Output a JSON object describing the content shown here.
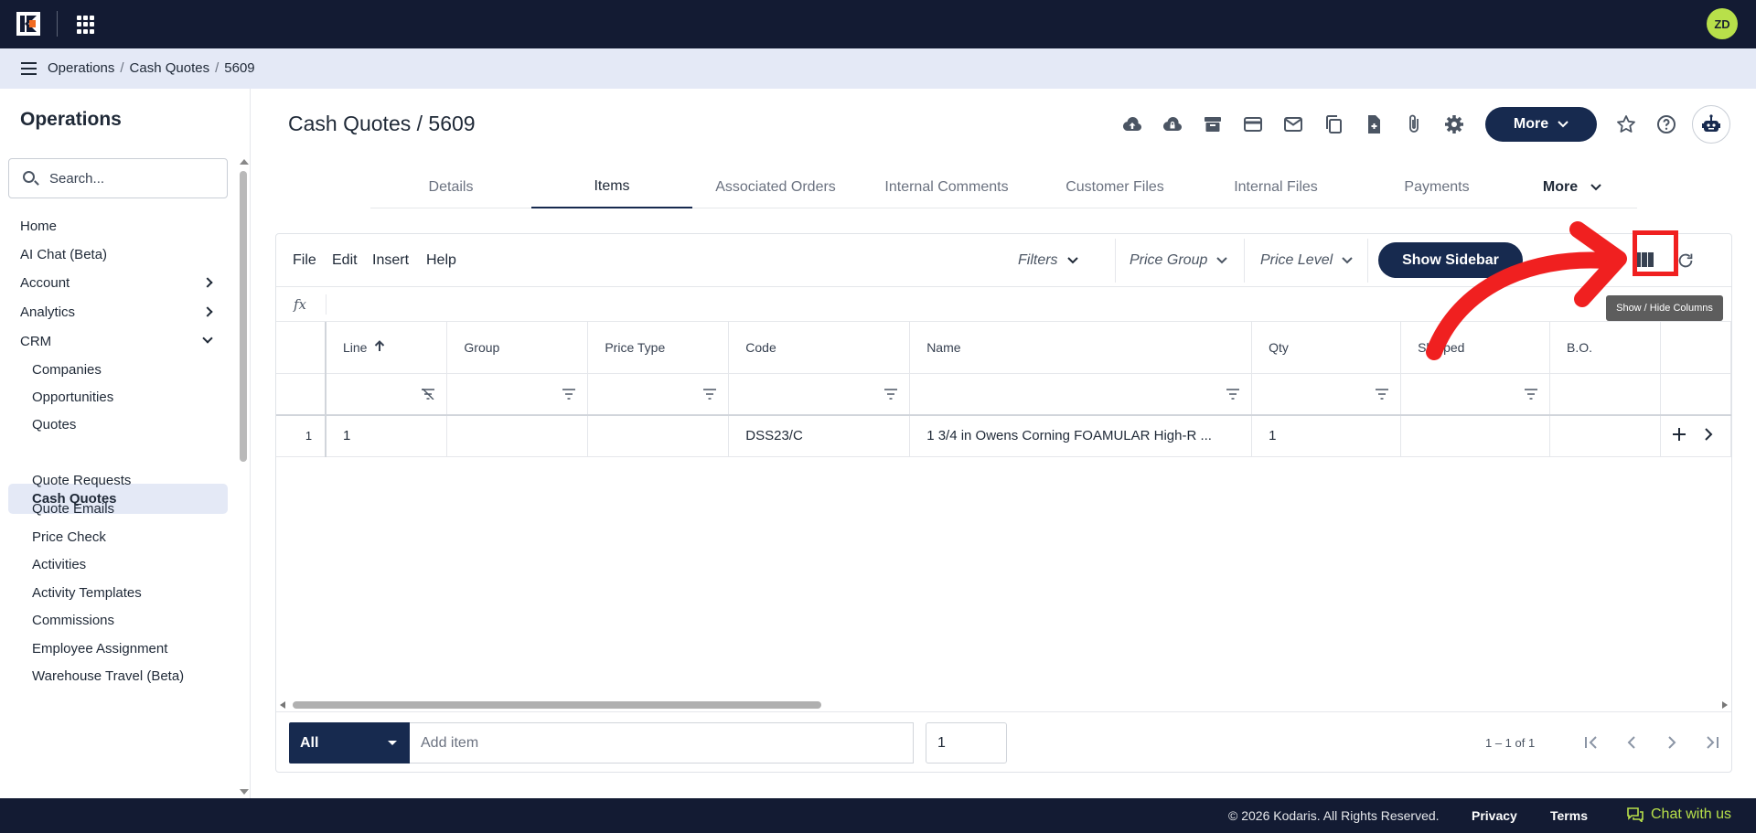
{
  "app": {
    "avatar_initials": "ZD"
  },
  "breadcrumb": {
    "items": [
      "Operations",
      "Cash Quotes",
      "5609"
    ],
    "separator": "/"
  },
  "sidebar": {
    "title": "Operations",
    "search_placeholder": "Search...",
    "items": [
      {
        "label": "Home"
      },
      {
        "label": "AI Chat (Beta)"
      },
      {
        "label": "Account"
      },
      {
        "label": "Analytics"
      },
      {
        "label": "CRM"
      },
      {
        "label": "Companies"
      },
      {
        "label": "Opportunities"
      },
      {
        "label": "Quotes"
      },
      {
        "label": "Cash Quotes"
      },
      {
        "label": "Quote Requests"
      },
      {
        "label": "Quote Emails"
      },
      {
        "label": "Price Check"
      },
      {
        "label": "Activities"
      },
      {
        "label": "Activity Templates"
      },
      {
        "label": "Commissions"
      },
      {
        "label": "Employee Assignment"
      },
      {
        "label": "Warehouse Travel (Beta)"
      }
    ]
  },
  "header": {
    "title": "Cash Quotes / 5609",
    "more_label": "More"
  },
  "tabs": [
    {
      "label": "Details"
    },
    {
      "label": "Items"
    },
    {
      "label": "Associated Orders"
    },
    {
      "label": "Internal Comments"
    },
    {
      "label": "Customer Files"
    },
    {
      "label": "Internal Files"
    },
    {
      "label": "Payments"
    },
    {
      "label": "More"
    }
  ],
  "toolbar": {
    "menus": [
      "File",
      "Edit",
      "Insert",
      "Help"
    ],
    "filters_label": "Filters",
    "price_group_label": "Price Group",
    "price_level_label": "Price Level",
    "show_sidebar_label": "Show Sidebar",
    "tooltip": "Show / Hide Columns"
  },
  "formula_bar": {
    "label": "fx"
  },
  "grid": {
    "columns": [
      "Line",
      "Group",
      "Price Type",
      "Code",
      "Name",
      "Qty",
      "Shipped",
      "B.O."
    ],
    "rows": [
      {
        "row_number": "1",
        "line": "1",
        "group": "",
        "price_type": "",
        "code": "DSS23/C",
        "name": "1 3/4 in Owens Corning FOAMULAR High-R ...",
        "qty": "1",
        "shipped": "",
        "bo": ""
      }
    ]
  },
  "footer_bar": {
    "scope_value": "All",
    "add_item_placeholder": "Add item",
    "quantity_value": "1",
    "pager_text": "1 – 1 of 1"
  },
  "footer": {
    "copyright": "© 2026 Kodaris. All Rights Reserved.",
    "privacy": "Privacy",
    "terms": "Terms",
    "chat": "Chat with us"
  },
  "colors": {
    "navy": "#131b33",
    "primary_button": "#172a4f",
    "accent_green": "#b8e04a",
    "breadcrumb_bg": "#e4e9f6",
    "annotation_red": "#f02020"
  }
}
